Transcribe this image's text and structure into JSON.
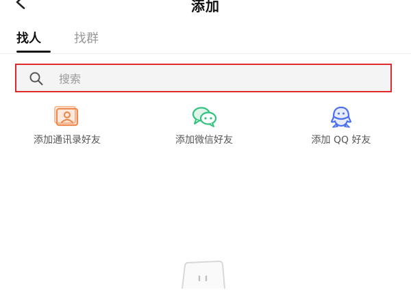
{
  "header": {
    "title": "添加",
    "back_icon": "chevron-left-icon"
  },
  "tabs": [
    {
      "label": "找人",
      "active": true
    },
    {
      "label": "找群",
      "active": false
    }
  ],
  "search": {
    "placeholder": "搜索",
    "value": "",
    "icon": "search-icon",
    "border_color": "#e0282b"
  },
  "options": [
    {
      "label": "添加通讯录好友",
      "icon": "contacts-card-icon",
      "color": "#ef8a4e"
    },
    {
      "label": "添加微信好友",
      "icon": "wechat-icon",
      "color": "#2fc37d"
    },
    {
      "label": "添加 QQ 好友",
      "icon": "qq-penguin-icon",
      "color": "#4b6ff0"
    }
  ]
}
